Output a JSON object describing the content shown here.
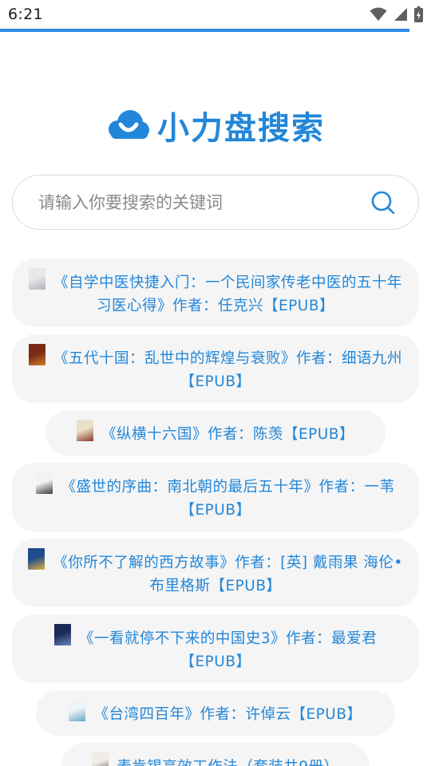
{
  "status_bar": {
    "time": "6:21",
    "icons": [
      "wifi-icon",
      "cellular-signal-icon",
      "battery-charging-icon"
    ]
  },
  "progress": {
    "fraction": 0.95,
    "color": "#2f8be6"
  },
  "brand": {
    "name": "小力盘搜索",
    "color": "#2387d9",
    "logo_icon": "cloud-smile-icon"
  },
  "search": {
    "placeholder": "请输入你要搜索的关键词",
    "value": "",
    "icon": "search-icon"
  },
  "results": [
    {
      "text": "《自学中医快捷入门：一个民间家传老中医的五十年习医心得》作者：任克兴【EPUB】",
      "thumb_colors": [
        "#e8e8e8",
        "#b0b4bc"
      ]
    },
    {
      "text": "《五代十国：乱世中的辉煌与衰败》作者：细语九州【EPUB】",
      "thumb_colors": [
        "#7a2a14",
        "#d07a2a"
      ]
    },
    {
      "text": "《纵横十六国》作者：陈羡【EPUB】",
      "thumb_colors": [
        "#e9e0c8",
        "#8a3a28"
      ]
    },
    {
      "text": "《盛世的序曲：南北朝的最后五十年》作者：一苇【EPUB】",
      "thumb_colors": [
        "#f2f2f2",
        "#3a3a3a"
      ]
    },
    {
      "text": "《你所不了解的西方故事》作者：[英] 戴雨果 海伦•布里格斯【EPUB】",
      "thumb_colors": [
        "#1f4c8c",
        "#e0b040"
      ]
    },
    {
      "text": "《一看就停不下来的中国史3》作者：最爱君【EPUB】",
      "thumb_colors": [
        "#1b2a55",
        "#6c86c4"
      ]
    },
    {
      "text": "《台湾四百年》作者：许倬云【EPUB】",
      "thumb_colors": [
        "#eef3f6",
        "#6aa6c8"
      ]
    },
    {
      "text": "麦肯锡高效工作法（套装共9册）",
      "thumb_colors": [
        "#f0ece4",
        "#555555"
      ]
    }
  ]
}
